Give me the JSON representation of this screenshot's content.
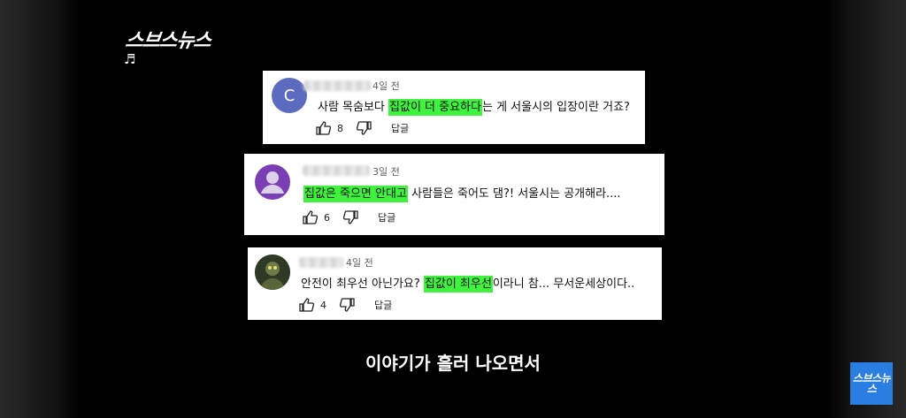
{
  "channel": {
    "logo_text": "스브스뉴스",
    "corner_logo_text": "스브스뉴스",
    "music_note": "♬"
  },
  "comments": [
    {
      "avatar_letter": "C",
      "avatar_color": "#5c6bc0",
      "time": "4일 전",
      "text_before": "사람 목숨보다 ",
      "highlight": "집값이 더 중요하다",
      "text_after": "는 게 서울시의 입장이란 거죠?",
      "likes": "8",
      "reply_label": "답글"
    },
    {
      "avatar_letter": "",
      "avatar_color": "#7b3fb5",
      "time": "3일 전",
      "text_before": "",
      "highlight": "집값은 죽으면 안대고",
      "text_after": " 사람들은 죽어도 댐?! 서울시는 공개해라....",
      "likes": "6",
      "reply_label": "답글"
    },
    {
      "avatar_letter": "",
      "avatar_color": "#3b4a2e",
      "time": "4일 전",
      "text_before": "안전이 최우선 아닌가요? ",
      "highlight": "집값이 최우선",
      "text_after": "이라니 참... 무서운세상이다..",
      "likes": "4",
      "reply_label": "답글"
    }
  ],
  "subtitle": "이야기가 흘러 나오면서",
  "highlight_color": "#3ef23e"
}
